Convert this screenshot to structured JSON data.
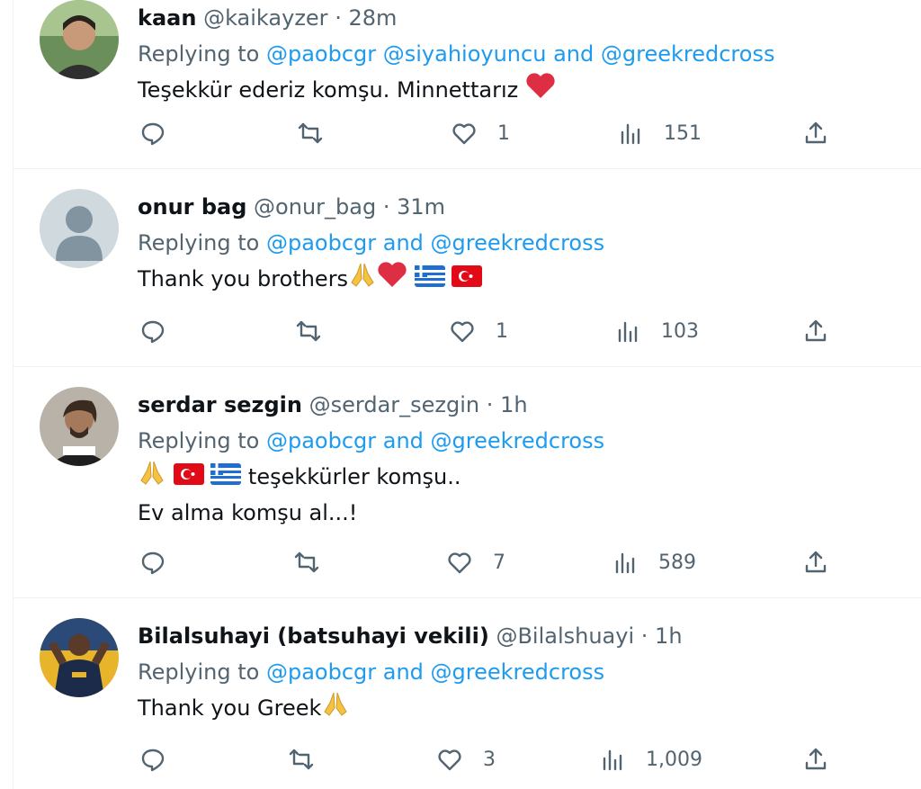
{
  "tweets": [
    {
      "name": "kaan",
      "handle": "@kaikayzer",
      "separator": "·",
      "time": "28m",
      "replying_prefix": "Replying to",
      "mentions": [
        "@paobcgr",
        "@siyahioyuncu",
        "and",
        "@greekredcross"
      ],
      "text_lines": [
        "Teşekkür ederiz komşu. Minnettarız"
      ],
      "emoji_suffix": [
        "red-heart"
      ],
      "likes": "1",
      "views": "151",
      "avatar": "photo"
    },
    {
      "name": "onur bag",
      "handle": "@onur_bag",
      "separator": "·",
      "time": "31m",
      "replying_prefix": "Replying to",
      "mentions": [
        "@paobcgr",
        "and",
        "@greekredcross"
      ],
      "text_lines": [
        "Thank you brothers"
      ],
      "emoji_suffix": [
        "folded-hands",
        "red-heart",
        "flag-greece",
        "flag-turkey"
      ],
      "likes": "1",
      "views": "103",
      "avatar": "default"
    },
    {
      "name": "serdar sezgin",
      "handle": "@serdar_sezgin",
      "separator": "·",
      "time": "1h",
      "replying_prefix": "Replying to",
      "mentions": [
        "@paobcgr",
        "and",
        "@greekredcross"
      ],
      "text_lines": [
        "teşekkürler komşu..",
        "Ev alma komşu al...!"
      ],
      "emoji_prefix": [
        "folded-hands",
        "flag-turkey",
        "flag-greece"
      ],
      "likes": "7",
      "views": "589",
      "avatar": "photo"
    },
    {
      "name": "Bilalsuhayi (batsuhayi vekili)",
      "handle": "@Bilalshuayi",
      "separator": "·",
      "time": "1h",
      "replying_prefix": "Replying to",
      "mentions": [
        "@paobcgr",
        "and",
        "@greekredcross"
      ],
      "text_lines": [
        "Thank you Greek"
      ],
      "emoji_suffix": [
        "folded-hands"
      ],
      "likes": "3",
      "views": "1,009",
      "avatar": "photo"
    }
  ],
  "colors": {
    "link": "#1d9bf0",
    "muted": "#536471",
    "text": "#0f1419",
    "border": "#eff3f4"
  },
  "icons": [
    "reply-icon",
    "retweet-icon",
    "like-icon",
    "views-icon",
    "share-icon"
  ]
}
